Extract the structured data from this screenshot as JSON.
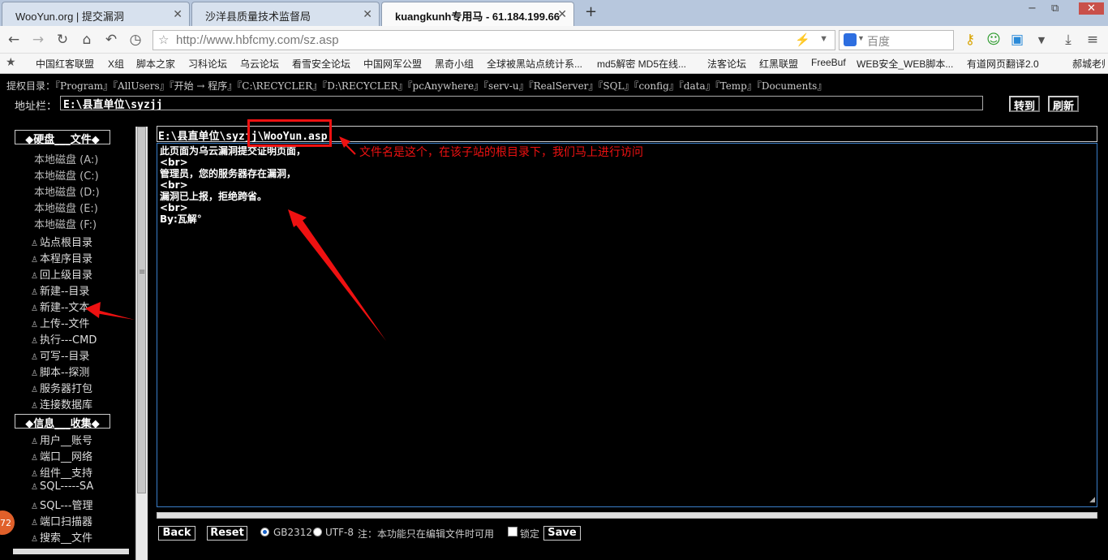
{
  "browser": {
    "tabs": [
      {
        "label": "WooYun.org | 提交漏洞",
        "active": false
      },
      {
        "label": "沙洋县质量技术监督局",
        "active": false
      },
      {
        "label": "kuangkunh专用马 - 61.184.199.66",
        "active": true
      }
    ],
    "new_tab": "+",
    "window_controls": {
      "minimize": "−",
      "restore": "⧉",
      "close": "✕"
    },
    "url": "http://www.hbfcmy.com/sz.asp",
    "search_placeholder": "百度",
    "bookmarks": [
      "中国红客联盟",
      "X组",
      "脚本之家",
      "习科论坛",
      "乌云论坛",
      "看雪安全论坛",
      "中国网军公盟",
      "黑奇小组",
      "全球被黑站点统计系...",
      "md5解密 MD5在线...",
      "法客论坛",
      "红黑联盟",
      "FreeBuf",
      "WEB安全_WEB脚本...",
      "有道网页翻译2.0",
      "郝城老师"
    ]
  },
  "webshell": {
    "tiquan_label": "提权目录：",
    "tiquan_dirs": "『Program』『AllUsers』『开始 → 程序』『C:\\RECYCLER』『D:\\RECYCLER』『pcAnywhere』『serv-u』『RealServer』『SQL』『config』『data』『Temp』『Documents』",
    "address_label": "地址栏：",
    "address_value": "E:\\县直单位\\syzjj",
    "goto_button": "转到",
    "refresh_button": "刷新",
    "sidebar": {
      "disk_header": "◆硬盘___文件◆",
      "drives": [
        "本地磁盘 (A:)",
        "本地磁盘 (C:)",
        "本地磁盘 (D:)",
        "本地磁盘 (E:)",
        "本地磁盘 (F:)"
      ],
      "file_items": [
        "站点根目录",
        "本程序目录",
        "回上级目录",
        "新建--目录",
        "新建--文本",
        "上传--文件",
        "执行---CMD",
        "可写--目录",
        "脚本--探测",
        "服务器打包",
        "连接数据库"
      ],
      "info_header": "◆信息___收集◆",
      "info_items": [
        "用户__账号",
        "端口__网络",
        "组件__支持",
        "SQL-----SA",
        "SQL---管理",
        "端口扫描器",
        "搜索__文件"
      ],
      "badge": "72"
    },
    "editor": {
      "file_path": "E:\\县直单位\\syzjj\\WooYun.asp",
      "lines": [
        "此页面为乌云漏洞提交证明页面，",
        "<br>",
        "管理员，您的服务器存在漏洞，",
        "<br>",
        "漏洞已上报，拒绝跨省。",
        "<br>",
        "By:瓦解°"
      ],
      "back_button": "Back",
      "reset_button": "Reset",
      "encoding_gb": "GB2312",
      "encoding_utf": "UTF-8",
      "encoding_selected": "GB2312",
      "note": "注：本功能只在编辑文件时可用",
      "lock_label": "锁定",
      "lock_checked": false,
      "save_button": "Save"
    },
    "annotation_text": "文件名是这个，在该子站的根目录下，我们马上进行访问",
    "annotation_color": "#e11111"
  }
}
